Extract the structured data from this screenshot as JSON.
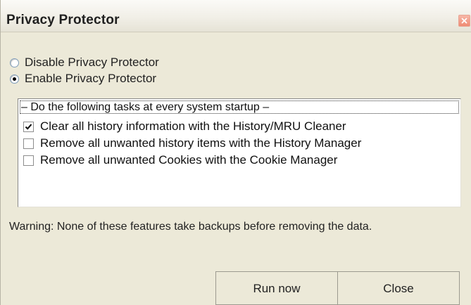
{
  "window": {
    "title": "Privacy Protector",
    "close_icon": "close-icon"
  },
  "mode": {
    "options": [
      {
        "label": "Disable Privacy Protector",
        "selected": false
      },
      {
        "label": "Enable Privacy Protector",
        "selected": true
      }
    ]
  },
  "tasks": {
    "header": "– Do the following tasks at every system startup –",
    "items": [
      {
        "label": "Clear all history information with the History/MRU Cleaner",
        "checked": true
      },
      {
        "label": "Remove all unwanted history items with the History Manager",
        "checked": false
      },
      {
        "label": "Remove all unwanted Cookies with the Cookie Manager",
        "checked": false
      }
    ]
  },
  "warning": "Warning: None of these features take backups before removing the data.",
  "buttons": {
    "run_now": "Run now",
    "close": "Close"
  },
  "colors": {
    "window_bg": "#ece9d8",
    "close_button": "#ef8a72",
    "list_bg": "#ffffff"
  }
}
